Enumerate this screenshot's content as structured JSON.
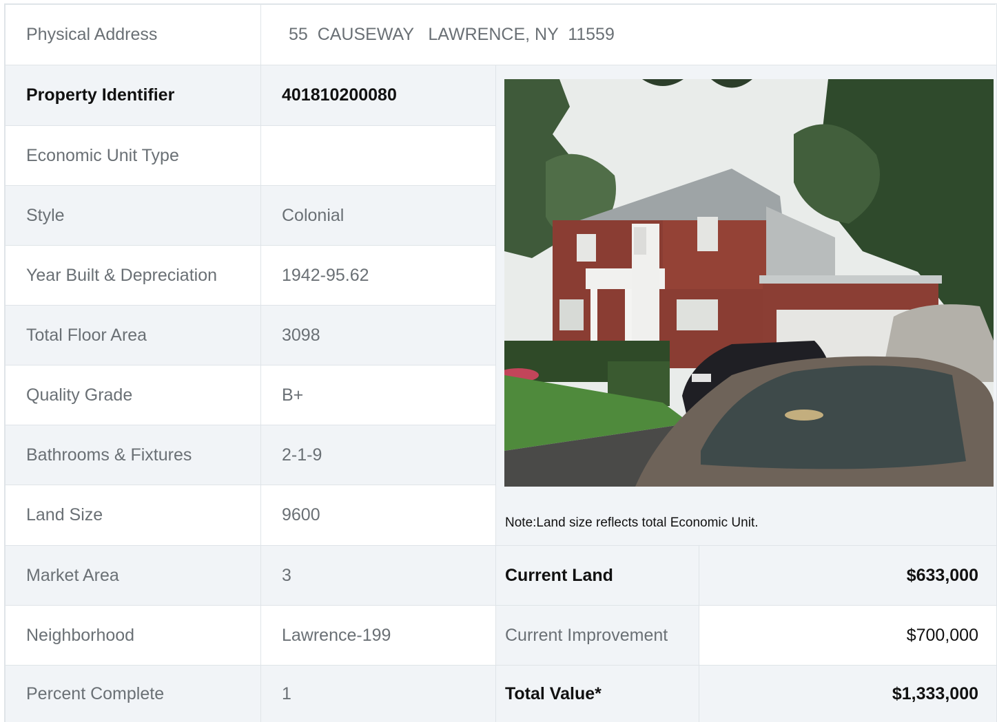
{
  "address": {
    "label": "Physical Address",
    "value": "55  CAUSEWAY   LAWRENCE, NY  11559"
  },
  "details": [
    {
      "label": "Property Identifier",
      "value": "401810200080"
    },
    {
      "label": "Economic Unit Type",
      "value": ""
    },
    {
      "label": "Style",
      "value": "Colonial"
    },
    {
      "label": "Year Built & Depreciation",
      "value": "1942-95.62"
    },
    {
      "label": "Total Floor Area",
      "value": "3098"
    },
    {
      "label": "Quality Grade",
      "value": "B+"
    },
    {
      "label": "Bathrooms & Fixtures",
      "value": "2-1-9"
    },
    {
      "label": "Land Size",
      "value": "9600"
    },
    {
      "label": "Market Area",
      "value": "3"
    },
    {
      "label": "Neighborhood",
      "value": "Lawrence-199"
    },
    {
      "label": "Percent Complete",
      "value": "1"
    }
  ],
  "note": "Note:Land size reflects total Economic Unit.",
  "valuation": [
    {
      "label": "Current Land",
      "value": "$633,000"
    },
    {
      "label": "Current Improvement",
      "value": "$700,000"
    },
    {
      "label": "Total Value*",
      "value": "$1,333,000"
    }
  ],
  "colors": {
    "row_alt": "#f1f4f7",
    "border": "#dfe4e8",
    "text_muted": "#6a7075",
    "text_strong": "#111111"
  }
}
